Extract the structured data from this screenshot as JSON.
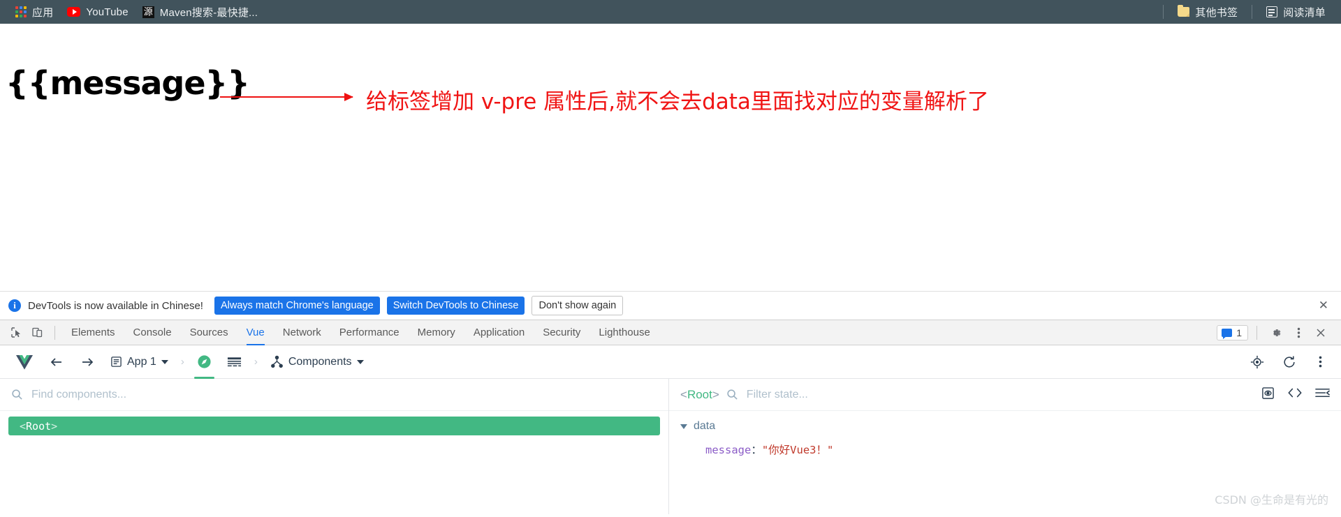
{
  "bookmarks_bar": {
    "items": [
      {
        "label": "应用",
        "icon": "apps-grid-icon"
      },
      {
        "label": "YouTube",
        "icon": "youtube-icon"
      },
      {
        "label": "Maven搜索-最快捷...",
        "icon": "maven-favicon",
        "favicon_char": "源"
      }
    ],
    "right_items": [
      {
        "label": "其他书签",
        "icon": "folder-icon"
      },
      {
        "label": "阅读清单",
        "icon": "reading-list-icon"
      }
    ]
  },
  "page": {
    "message_binding": "{{message}}",
    "annotation": "给标签增加 v-pre 属性后,就不会去data里面找对应的变量解析了",
    "annotation_color": "#f01414",
    "arrow_icon": "right-arrow-icon"
  },
  "devtools_notice": {
    "info_icon": "info-icon",
    "info_char": "i",
    "text": "DevTools is now available in Chinese!",
    "buttons": [
      {
        "label": "Always match Chrome's language",
        "style": "primary"
      },
      {
        "label": "Switch DevTools to Chinese",
        "style": "primary"
      },
      {
        "label": "Don't show again",
        "style": "secondary"
      }
    ],
    "close_icon": "close-icon",
    "close_char": "✕",
    "accent": "#1a73e8"
  },
  "devtools_tabbar": {
    "tools": [
      {
        "name": "inspect-element-icon"
      },
      {
        "name": "device-toolbar-icon"
      }
    ],
    "tabs": [
      {
        "label": "Elements",
        "active": false
      },
      {
        "label": "Console",
        "active": false
      },
      {
        "label": "Sources",
        "active": false
      },
      {
        "label": "Vue",
        "active": true
      },
      {
        "label": "Network",
        "active": false
      },
      {
        "label": "Performance",
        "active": false
      },
      {
        "label": "Memory",
        "active": false
      },
      {
        "label": "Application",
        "active": false
      },
      {
        "label": "Security",
        "active": false
      },
      {
        "label": "Lighthouse",
        "active": false
      }
    ],
    "message_count": "1",
    "right_icons": [
      "message-count-badge",
      "settings-gear-icon",
      "more-options-icon",
      "close-devtools-icon"
    ],
    "active_color": "#1a73e8"
  },
  "vue_toolbar": {
    "logo_icon": "vue-logo-icon",
    "back_icon": "back-arrow-icon",
    "forward_icon": "forward-arrow-icon",
    "app_label": "App 1",
    "app_icon": "app-document-icon",
    "compass_icon": "vue-inspector-icon",
    "grid_icon": "timeline-grid-icon",
    "view_label": "Components",
    "view_icon": "components-tree-icon",
    "right_icons": [
      "select-component-icon",
      "refresh-icon",
      "more-options-icon"
    ],
    "accent": "#42b883"
  },
  "tree_pane": {
    "search_placeholder": "Find components...",
    "search_value": "",
    "search_icon": "search-icon",
    "nodes": [
      {
        "open_bracket": "<",
        "name": "Root",
        "close_bracket": ">",
        "selected": true
      }
    ]
  },
  "state_pane": {
    "root_tag_open": "<",
    "root_tag_name": "Root",
    "root_tag_close": ">",
    "search_icon": "search-icon",
    "filter_placeholder": "Filter state...",
    "filter_value": "",
    "header_icons": [
      "inspect-dom-icon",
      "open-in-editor-icon",
      "collapse-all-icon"
    ],
    "groups": [
      {
        "label": "data",
        "expanded": true,
        "rows": [
          {
            "key": "message",
            "colon": "：",
            "value": "\"你好Vue3！\""
          }
        ]
      }
    ]
  },
  "watermark": "CSDN @生命是有光的"
}
